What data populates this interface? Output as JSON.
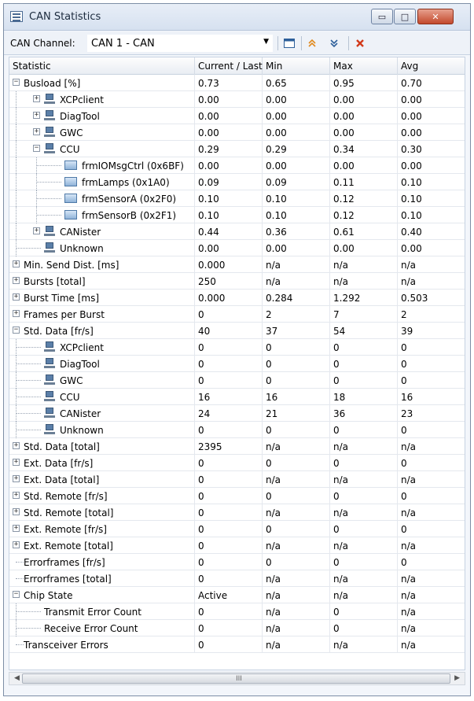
{
  "window": {
    "title": "CAN Statistics",
    "buttons": {
      "minimize": "▭",
      "maximize": "□",
      "close": "✕"
    }
  },
  "toolbar": {
    "channel_label": "CAN Channel:",
    "channel_value": "CAN 1 - CAN",
    "dropdown_arrow": "▼",
    "icons": [
      "window-icon",
      "collapse-all-icon",
      "expand-all-icon",
      "reset-icon"
    ]
  },
  "columns": [
    "Statistic",
    "Current / Last",
    "Min",
    "Max",
    "Avg"
  ],
  "rows": [
    {
      "label": "Busload [%]",
      "level": 0,
      "expander": "-",
      "icon": "",
      "values": [
        "0.73",
        "0.65",
        "0.95",
        "0.70"
      ]
    },
    {
      "label": "XCPclient",
      "level": 1,
      "expander": "+",
      "icon": "node",
      "values": [
        "0.00",
        "0.00",
        "0.00",
        "0.00"
      ]
    },
    {
      "label": "DiagTool",
      "level": 1,
      "expander": "+",
      "icon": "node",
      "values": [
        "0.00",
        "0.00",
        "0.00",
        "0.00"
      ]
    },
    {
      "label": "GWC",
      "level": 1,
      "expander": "+",
      "icon": "node",
      "values": [
        "0.00",
        "0.00",
        "0.00",
        "0.00"
      ]
    },
    {
      "label": "CCU",
      "level": 1,
      "expander": "-",
      "icon": "node",
      "values": [
        "0.29",
        "0.29",
        "0.34",
        "0.30"
      ]
    },
    {
      "label": "frmIOMsgCtrl (0x6BF)",
      "level": 2,
      "expander": "",
      "icon": "msg",
      "values": [
        "0.00",
        "0.00",
        "0.00",
        "0.00"
      ]
    },
    {
      "label": "frmLamps (0x1A0)",
      "level": 2,
      "expander": "",
      "icon": "msg",
      "values": [
        "0.09",
        "0.09",
        "0.11",
        "0.10"
      ]
    },
    {
      "label": "frmSensorA (0x2F0)",
      "level": 2,
      "expander": "",
      "icon": "msg",
      "values": [
        "0.10",
        "0.10",
        "0.12",
        "0.10"
      ]
    },
    {
      "label": "frmSensorB (0x2F1)",
      "level": 2,
      "expander": "",
      "icon": "msg",
      "values": [
        "0.10",
        "0.10",
        "0.12",
        "0.10"
      ]
    },
    {
      "label": "CANister",
      "level": 1,
      "expander": "+",
      "icon": "node",
      "values": [
        "0.44",
        "0.36",
        "0.61",
        "0.40"
      ]
    },
    {
      "label": "Unknown",
      "level": 1,
      "expander": "",
      "icon": "node",
      "values": [
        "0.00",
        "0.00",
        "0.00",
        "0.00"
      ]
    },
    {
      "label": "Min. Send Dist. [ms]",
      "level": 0,
      "expander": "+",
      "icon": "",
      "values": [
        "0.000",
        "n/a",
        "n/a",
        "n/a"
      ]
    },
    {
      "label": "Bursts [total]",
      "level": 0,
      "expander": "+",
      "icon": "",
      "values": [
        "250",
        "n/a",
        "n/a",
        "n/a"
      ]
    },
    {
      "label": "Burst Time [ms]",
      "level": 0,
      "expander": "+",
      "icon": "",
      "values": [
        "0.000",
        "0.284",
        "1.292",
        "0.503"
      ]
    },
    {
      "label": "Frames per Burst",
      "level": 0,
      "expander": "+",
      "icon": "",
      "values": [
        "0",
        "2",
        "7",
        "2"
      ]
    },
    {
      "label": "Std. Data [fr/s]",
      "level": 0,
      "expander": "-",
      "icon": "",
      "values": [
        "40",
        "37",
        "54",
        "39"
      ]
    },
    {
      "label": "XCPclient",
      "level": 1,
      "expander": "",
      "icon": "node",
      "values": [
        "0",
        "0",
        "0",
        "0"
      ]
    },
    {
      "label": "DiagTool",
      "level": 1,
      "expander": "",
      "icon": "node",
      "values": [
        "0",
        "0",
        "0",
        "0"
      ]
    },
    {
      "label": "GWC",
      "level": 1,
      "expander": "",
      "icon": "node",
      "values": [
        "0",
        "0",
        "0",
        "0"
      ]
    },
    {
      "label": "CCU",
      "level": 1,
      "expander": "",
      "icon": "node",
      "values": [
        "16",
        "16",
        "18",
        "16"
      ]
    },
    {
      "label": "CANister",
      "level": 1,
      "expander": "",
      "icon": "node",
      "values": [
        "24",
        "21",
        "36",
        "23"
      ]
    },
    {
      "label": "Unknown",
      "level": 1,
      "expander": "",
      "icon": "node",
      "values": [
        "0",
        "0",
        "0",
        "0"
      ]
    },
    {
      "label": "Std. Data [total]",
      "level": 0,
      "expander": "+",
      "icon": "",
      "values": [
        "2395",
        "n/a",
        "n/a",
        "n/a"
      ]
    },
    {
      "label": "Ext. Data [fr/s]",
      "level": 0,
      "expander": "+",
      "icon": "",
      "values": [
        "0",
        "0",
        "0",
        "0"
      ]
    },
    {
      "label": "Ext. Data [total]",
      "level": 0,
      "expander": "+",
      "icon": "",
      "values": [
        "0",
        "n/a",
        "n/a",
        "n/a"
      ]
    },
    {
      "label": "Std. Remote [fr/s]",
      "level": 0,
      "expander": "+",
      "icon": "",
      "values": [
        "0",
        "0",
        "0",
        "0"
      ]
    },
    {
      "label": "Std. Remote [total]",
      "level": 0,
      "expander": "+",
      "icon": "",
      "values": [
        "0",
        "n/a",
        "n/a",
        "n/a"
      ]
    },
    {
      "label": "Ext. Remote [fr/s]",
      "level": 0,
      "expander": "+",
      "icon": "",
      "values": [
        "0",
        "0",
        "0",
        "0"
      ]
    },
    {
      "label": "Ext. Remote [total]",
      "level": 0,
      "expander": "+",
      "icon": "",
      "values": [
        "0",
        "n/a",
        "n/a",
        "n/a"
      ]
    },
    {
      "label": "Errorframes [fr/s]",
      "level": 0,
      "expander": "",
      "icon": "",
      "values": [
        "0",
        "0",
        "0",
        "0"
      ]
    },
    {
      "label": "Errorframes [total]",
      "level": 0,
      "expander": "",
      "icon": "",
      "values": [
        "0",
        "n/a",
        "n/a",
        "n/a"
      ]
    },
    {
      "label": "Chip State",
      "level": 0,
      "expander": "-",
      "icon": "",
      "values": [
        "Active",
        "n/a",
        "n/a",
        "n/a"
      ]
    },
    {
      "label": "Transmit Error Count",
      "level": 1,
      "expander": "",
      "icon": "",
      "values": [
        "0",
        "n/a",
        "0",
        "n/a"
      ]
    },
    {
      "label": "Receive Error Count",
      "level": 1,
      "expander": "",
      "icon": "",
      "values": [
        "0",
        "n/a",
        "0",
        "n/a"
      ]
    },
    {
      "label": "Transceiver Errors",
      "level": 0,
      "expander": "",
      "icon": "",
      "values": [
        "0",
        "n/a",
        "n/a",
        "n/a"
      ]
    }
  ],
  "scrollbar": {
    "left": "◀",
    "right": "▶",
    "grip": "III"
  }
}
